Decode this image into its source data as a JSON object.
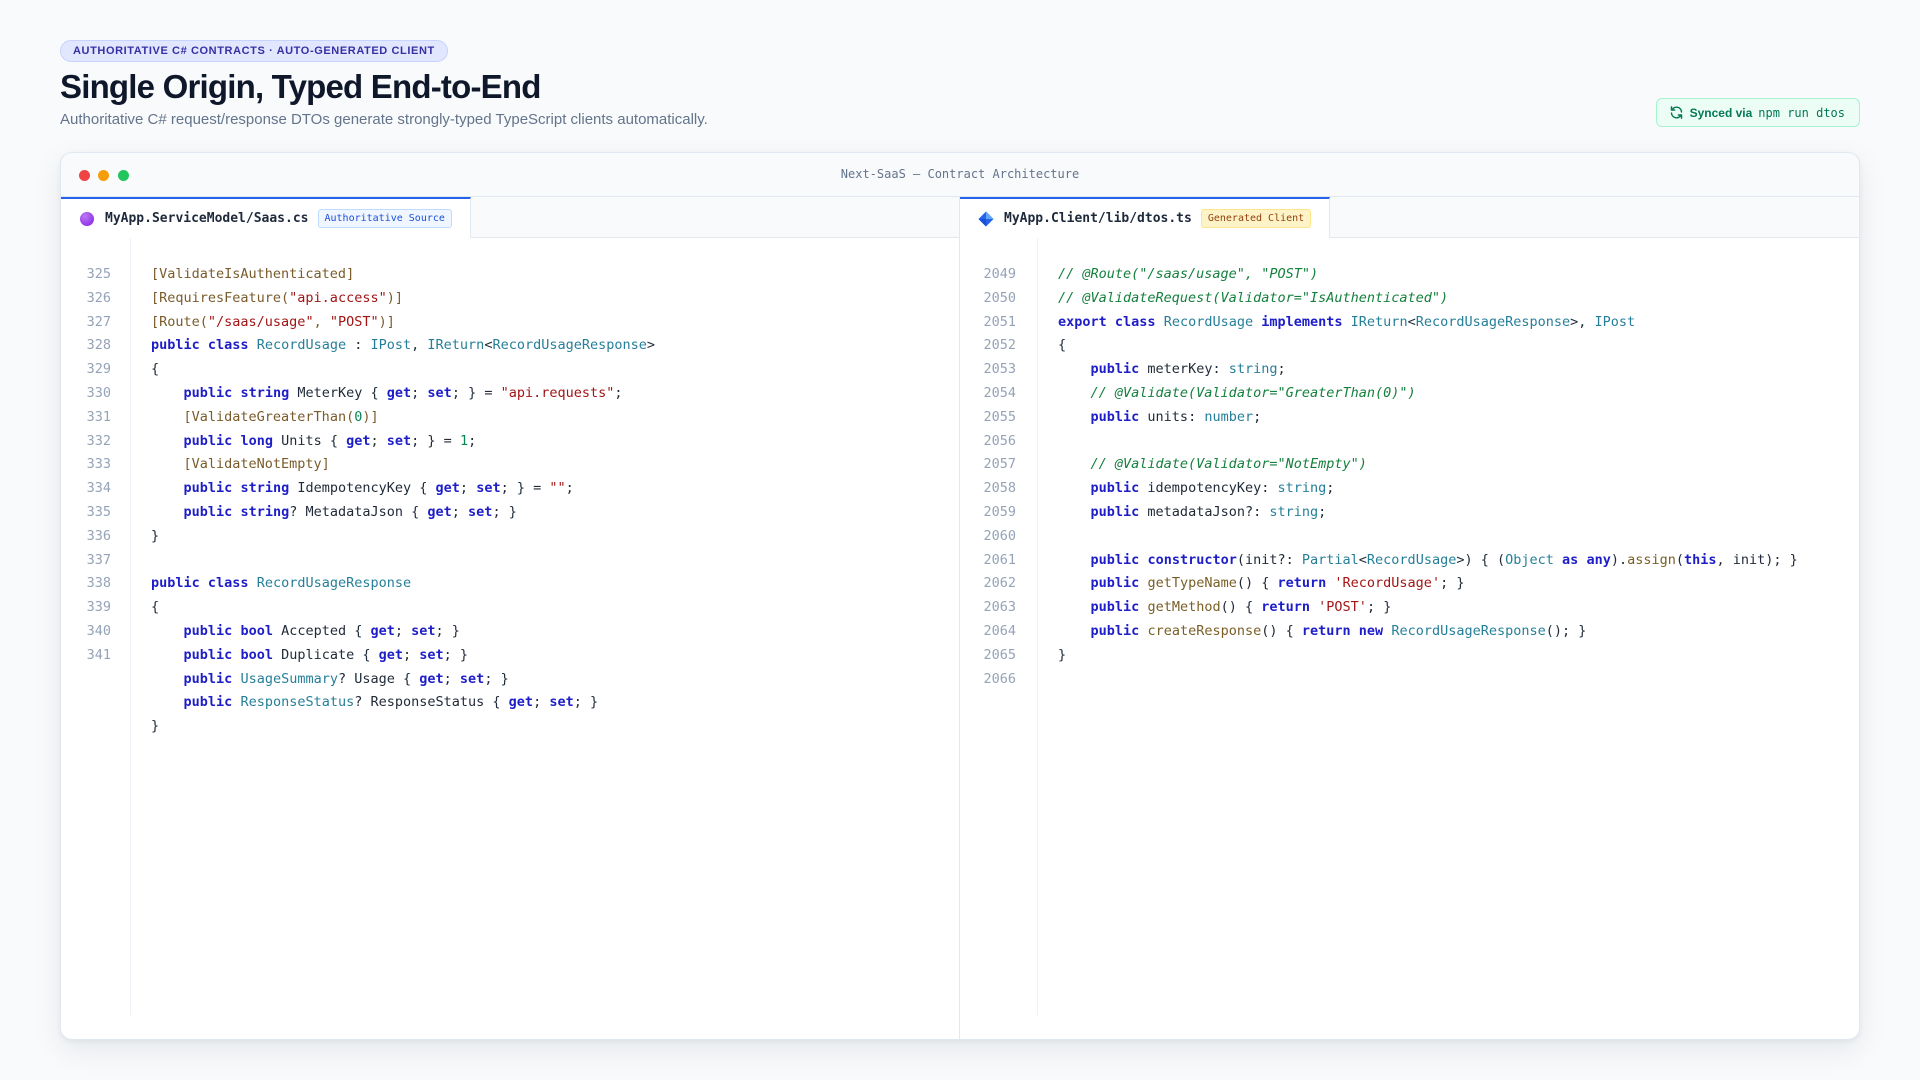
{
  "header": {
    "eyebrow": "AUTHORITATIVE C# CONTRACTS · AUTO-GENERATED CLIENT",
    "title": "Single Origin, Typed End-to-End",
    "subtitle": "Authoritative C# request/response DTOs generate strongly-typed TypeScript clients automatically.",
    "sync_label": "Synced via",
    "sync_command": "npm run dtos"
  },
  "window": {
    "title": "Next-SaaS — Contract Architecture"
  },
  "left_pane": {
    "filename": "MyApp.ServiceModel/Saas.cs",
    "tag": "Authoritative Source",
    "line_numbers": [
      "325",
      "326",
      "327",
      "328",
      "329",
      "330",
      "331",
      "332",
      "333",
      "334",
      "335",
      "336",
      "337",
      "338",
      "339",
      "340",
      "341"
    ],
    "lines": [
      [
        [
          "attr",
          "[ValidateIsAuthenticated]"
        ]
      ],
      [
        [
          "attr",
          "[RequiresFeature("
        ],
        [
          "str",
          "\"api.access\""
        ],
        [
          "attr",
          ")]"
        ]
      ],
      [
        [
          "attr",
          "[Route("
        ],
        [
          "str",
          "\"/saas/usage\""
        ],
        [
          "attr",
          ", "
        ],
        [
          "str",
          "\"POST\""
        ],
        [
          "attr",
          ")]"
        ]
      ],
      [
        [
          "kw",
          "public"
        ],
        [
          "plain",
          " "
        ],
        [
          "kw",
          "class"
        ],
        [
          "plain",
          " "
        ],
        [
          "type",
          "RecordUsage"
        ],
        [
          "plain",
          " : "
        ],
        [
          "type",
          "IPost"
        ],
        [
          "plain",
          ", "
        ],
        [
          "type",
          "IReturn"
        ],
        [
          "plain",
          "<"
        ],
        [
          "type",
          "RecordUsageResponse"
        ],
        [
          "plain",
          ">"
        ]
      ],
      [
        [
          "plain",
          "{"
        ]
      ],
      [
        [
          "plain",
          "    "
        ],
        [
          "kw",
          "public"
        ],
        [
          "plain",
          " "
        ],
        [
          "kw",
          "string"
        ],
        [
          "plain",
          " MeterKey { "
        ],
        [
          "kw",
          "get"
        ],
        [
          "plain",
          "; "
        ],
        [
          "kw",
          "set"
        ],
        [
          "plain",
          "; } = "
        ],
        [
          "str",
          "\"api.requests\""
        ],
        [
          "plain",
          ";"
        ]
      ],
      [
        [
          "plain",
          "    "
        ],
        [
          "attr",
          "[ValidateGreaterThan("
        ],
        [
          "num",
          "0"
        ],
        [
          "attr",
          ")]"
        ]
      ],
      [
        [
          "plain",
          "    "
        ],
        [
          "kw",
          "public"
        ],
        [
          "plain",
          " "
        ],
        [
          "kw",
          "long"
        ],
        [
          "plain",
          " Units { "
        ],
        [
          "kw",
          "get"
        ],
        [
          "plain",
          "; "
        ],
        [
          "kw",
          "set"
        ],
        [
          "plain",
          "; } = "
        ],
        [
          "num",
          "1"
        ],
        [
          "plain",
          ";"
        ]
      ],
      [
        [
          "plain",
          "    "
        ],
        [
          "attr",
          "[ValidateNotEmpty]"
        ]
      ],
      [
        [
          "plain",
          "    "
        ],
        [
          "kw",
          "public"
        ],
        [
          "plain",
          " "
        ],
        [
          "kw",
          "string"
        ],
        [
          "plain",
          " IdempotencyKey { "
        ],
        [
          "kw",
          "get"
        ],
        [
          "plain",
          "; "
        ],
        [
          "kw",
          "set"
        ],
        [
          "plain",
          "; } = "
        ],
        [
          "str",
          "\"\""
        ],
        [
          "plain",
          ";"
        ]
      ],
      [
        [
          "plain",
          "    "
        ],
        [
          "kw",
          "public"
        ],
        [
          "plain",
          " "
        ],
        [
          "kw",
          "string"
        ],
        [
          "plain",
          "? MetadataJson { "
        ],
        [
          "kw",
          "get"
        ],
        [
          "plain",
          "; "
        ],
        [
          "kw",
          "set"
        ],
        [
          "plain",
          "; }"
        ]
      ],
      [
        [
          "plain",
          "}"
        ]
      ],
      [
        [
          "plain",
          ""
        ]
      ],
      [
        [
          "kw",
          "public"
        ],
        [
          "plain",
          " "
        ],
        [
          "kw",
          "class"
        ],
        [
          "plain",
          " "
        ],
        [
          "type",
          "RecordUsageResponse"
        ]
      ],
      [
        [
          "plain",
          "{"
        ]
      ],
      [
        [
          "plain",
          "    "
        ],
        [
          "kw",
          "public"
        ],
        [
          "plain",
          " "
        ],
        [
          "kw",
          "bool"
        ],
        [
          "plain",
          " Accepted { "
        ],
        [
          "kw",
          "get"
        ],
        [
          "plain",
          "; "
        ],
        [
          "kw",
          "set"
        ],
        [
          "plain",
          "; }"
        ]
      ],
      [
        [
          "plain",
          "    "
        ],
        [
          "kw",
          "public"
        ],
        [
          "plain",
          " "
        ],
        [
          "kw",
          "bool"
        ],
        [
          "plain",
          " Duplicate { "
        ],
        [
          "kw",
          "get"
        ],
        [
          "plain",
          "; "
        ],
        [
          "kw",
          "set"
        ],
        [
          "plain",
          "; }"
        ]
      ],
      [
        [
          "plain",
          "    "
        ],
        [
          "kw",
          "public"
        ],
        [
          "plain",
          " "
        ],
        [
          "type",
          "UsageSummary"
        ],
        [
          "plain",
          "? Usage { "
        ],
        [
          "kw",
          "get"
        ],
        [
          "plain",
          "; "
        ],
        [
          "kw",
          "set"
        ],
        [
          "plain",
          "; }"
        ]
      ],
      [
        [
          "plain",
          "    "
        ],
        [
          "kw",
          "public"
        ],
        [
          "plain",
          " "
        ],
        [
          "type",
          "ResponseStatus"
        ],
        [
          "plain",
          "? ResponseStatus { "
        ],
        [
          "kw",
          "get"
        ],
        [
          "plain",
          "; "
        ],
        [
          "kw",
          "set"
        ],
        [
          "plain",
          "; }"
        ]
      ],
      [
        [
          "plain",
          "}"
        ]
      ]
    ]
  },
  "right_pane": {
    "filename": "MyApp.Client/lib/dtos.ts",
    "tag": "Generated Client",
    "line_numbers": [
      "2049",
      "2050",
      "2051",
      "2052",
      "2053",
      "2054",
      "2055",
      "2056",
      "2057",
      "2058",
      "2059",
      "2060",
      "2061",
      "2062",
      "2063",
      "2064",
      "2065",
      "2066"
    ],
    "lines": [
      [
        [
          "cm",
          "// @Route(\"/saas/usage\", \"POST\")"
        ]
      ],
      [
        [
          "cm",
          "// @ValidateRequest(Validator=\"IsAuthenticated\")"
        ]
      ],
      [
        [
          "kw",
          "export"
        ],
        [
          "plain",
          " "
        ],
        [
          "kw",
          "class"
        ],
        [
          "plain",
          " "
        ],
        [
          "type",
          "RecordUsage"
        ],
        [
          "plain",
          " "
        ],
        [
          "kw",
          "implements"
        ],
        [
          "plain",
          " "
        ],
        [
          "type",
          "IReturn"
        ],
        [
          "plain",
          "<"
        ],
        [
          "type",
          "RecordUsageResponse"
        ],
        [
          "plain",
          ">, "
        ],
        [
          "type",
          "IPost"
        ]
      ],
      [
        [
          "plain",
          "{"
        ]
      ],
      [
        [
          "plain",
          "    "
        ],
        [
          "kw",
          "public"
        ],
        [
          "plain",
          " meterKey: "
        ],
        [
          "type",
          "string"
        ],
        [
          "plain",
          ";"
        ]
      ],
      [
        [
          "plain",
          "    "
        ],
        [
          "cm",
          "// @Validate(Validator=\"GreaterThan(0)\")"
        ]
      ],
      [
        [
          "plain",
          "    "
        ],
        [
          "kw",
          "public"
        ],
        [
          "plain",
          " units: "
        ],
        [
          "type",
          "number"
        ],
        [
          "plain",
          ";"
        ]
      ],
      [
        [
          "plain",
          ""
        ]
      ],
      [
        [
          "plain",
          "    "
        ],
        [
          "cm",
          "// @Validate(Validator=\"NotEmpty\")"
        ]
      ],
      [
        [
          "plain",
          "    "
        ],
        [
          "kw",
          "public"
        ],
        [
          "plain",
          " idempotencyKey: "
        ],
        [
          "type",
          "string"
        ],
        [
          "plain",
          ";"
        ]
      ],
      [
        [
          "plain",
          "    "
        ],
        [
          "kw",
          "public"
        ],
        [
          "plain",
          " metadataJson?: "
        ],
        [
          "type",
          "string"
        ],
        [
          "plain",
          ";"
        ]
      ],
      [
        [
          "plain",
          ""
        ]
      ],
      [
        [
          "plain",
          "    "
        ],
        [
          "kw",
          "public"
        ],
        [
          "plain",
          " "
        ],
        [
          "kw",
          "constructor"
        ],
        [
          "plain",
          "(init?: "
        ],
        [
          "type",
          "Partial"
        ],
        [
          "plain",
          "<"
        ],
        [
          "type",
          "RecordUsage"
        ],
        [
          "plain",
          ">) { ("
        ],
        [
          "type",
          "Object"
        ],
        [
          "plain",
          " "
        ],
        [
          "kw",
          "as"
        ],
        [
          "plain",
          " "
        ],
        [
          "kw",
          "any"
        ],
        [
          "plain",
          ")."
        ],
        [
          "fn",
          "assign"
        ],
        [
          "plain",
          "("
        ],
        [
          "kw",
          "this"
        ],
        [
          "plain",
          ", init); }"
        ]
      ],
      [
        [
          "plain",
          "    "
        ],
        [
          "kw",
          "public"
        ],
        [
          "plain",
          " "
        ],
        [
          "fn",
          "getTypeName"
        ],
        [
          "plain",
          "() { "
        ],
        [
          "kw",
          "return"
        ],
        [
          "plain",
          " "
        ],
        [
          "str",
          "'RecordUsage'"
        ],
        [
          "plain",
          "; }"
        ]
      ],
      [
        [
          "plain",
          "    "
        ],
        [
          "kw",
          "public"
        ],
        [
          "plain",
          " "
        ],
        [
          "fn",
          "getMethod"
        ],
        [
          "plain",
          "() { "
        ],
        [
          "kw",
          "return"
        ],
        [
          "plain",
          " "
        ],
        [
          "str",
          "'POST'"
        ],
        [
          "plain",
          "; }"
        ]
      ],
      [
        [
          "plain",
          "    "
        ],
        [
          "kw",
          "public"
        ],
        [
          "plain",
          " "
        ],
        [
          "fn",
          "createResponse"
        ],
        [
          "plain",
          "() { "
        ],
        [
          "kw",
          "return"
        ],
        [
          "plain",
          " "
        ],
        [
          "kw",
          "new"
        ],
        [
          "plain",
          " "
        ],
        [
          "type",
          "RecordUsageResponse"
        ],
        [
          "plain",
          "(); }"
        ]
      ],
      [
        [
          "plain",
          "}"
        ]
      ]
    ]
  },
  "colors": {
    "keyword": "#1e1ec8",
    "type": "#267f99",
    "string": "#a31515",
    "number": "#098658",
    "attribute": "#7a5b2a",
    "comment": "#15803d",
    "accent": "#2563eb"
  },
  "icons": {
    "sync": "refresh-icon",
    "left_file": "csharp-file-icon",
    "right_file": "typescript-file-icon"
  }
}
